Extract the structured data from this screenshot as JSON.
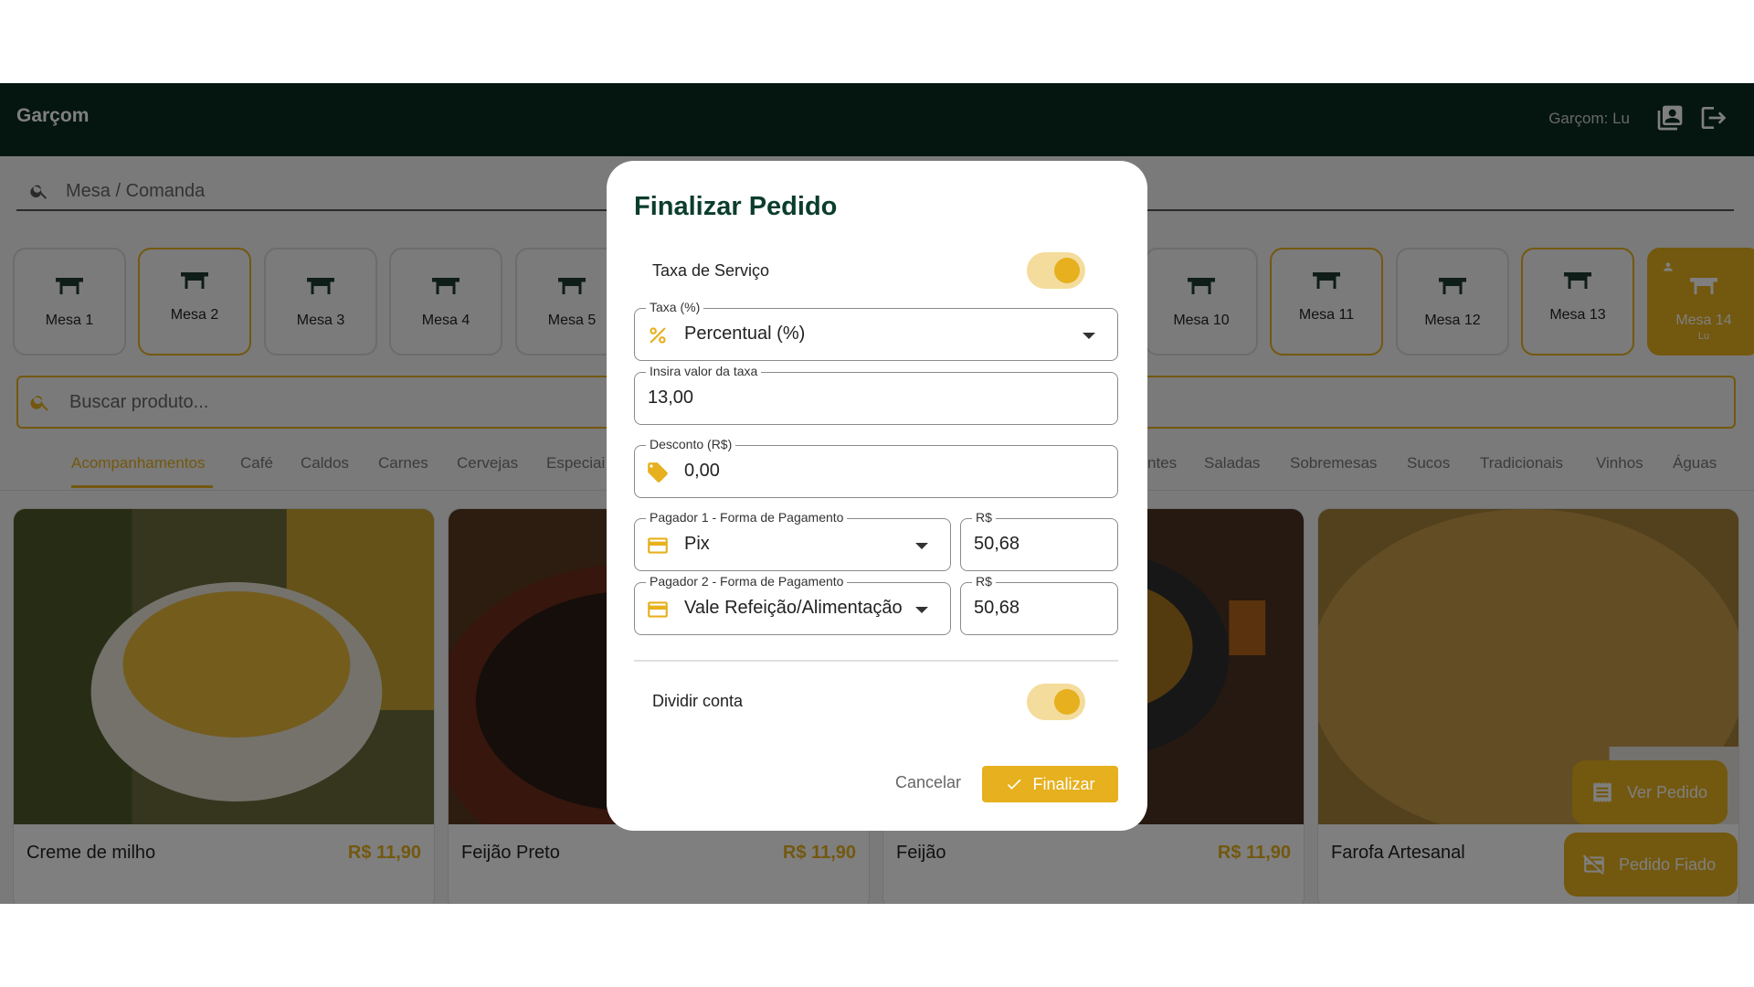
{
  "header": {
    "brand": "Garçom",
    "user_label": "Garçom: Lu",
    "icons": [
      "orders-icon",
      "logout-icon"
    ]
  },
  "mesa_search": {
    "placeholder": "Mesa / Comanda"
  },
  "mesas": [
    {
      "label": "Mesa 1",
      "state": "free"
    },
    {
      "label": "Mesa 2",
      "state": "busy"
    },
    {
      "label": "Mesa 3",
      "state": "free"
    },
    {
      "label": "Mesa 4",
      "state": "free"
    },
    {
      "label": "Mesa 5",
      "state": "free"
    },
    {
      "label": "Mesa 10",
      "state": "free"
    },
    {
      "label": "Mesa 11",
      "state": "busy"
    },
    {
      "label": "Mesa 12",
      "state": "free"
    },
    {
      "label": "Mesa 13",
      "state": "busy"
    },
    {
      "label": "Mesa 14",
      "state": "active",
      "sub": "Lu"
    }
  ],
  "product_search": {
    "placeholder": "Buscar produto..."
  },
  "tabs": [
    {
      "label": "Acompanhamentos",
      "active": true
    },
    {
      "label": "Café"
    },
    {
      "label": "Caldos"
    },
    {
      "label": "Carnes"
    },
    {
      "label": "Cervejas"
    },
    {
      "label": "Especiai"
    },
    {
      "label": "ntes"
    },
    {
      "label": "Saladas"
    },
    {
      "label": "Sobremesas"
    },
    {
      "label": "Sucos"
    },
    {
      "label": "Tradicionais"
    },
    {
      "label": "Vinhos"
    },
    {
      "label": "Águas"
    }
  ],
  "products": [
    {
      "name": "Creme de milho",
      "price": "R$ 11,90"
    },
    {
      "name": "Feijão Preto",
      "price": "R$ 11,90"
    },
    {
      "name": "Feijão",
      "price": "R$ 11,90"
    },
    {
      "name": "Farofa Artesanal",
      "price": ""
    }
  ],
  "fabs": {
    "ver_pedido": "Ver Pedido",
    "pedido_fiado": "Pedido Fiado"
  },
  "dialog": {
    "title": "Finalizar Pedido",
    "taxa_servico_label": "Taxa de Serviço",
    "taxa_servico_on": true,
    "taxa_tipo": {
      "label": "Taxa (%)",
      "value": "Percentual (%)"
    },
    "taxa_valor": {
      "label": "Insira valor da taxa",
      "value": "13,00"
    },
    "desconto": {
      "label": "Desconto (R$)",
      "value": "0,00"
    },
    "pagador1": {
      "label": "Pagador 1 - Forma de Pagamento",
      "value": "Pix",
      "amount_label": "R$",
      "amount": "50,68"
    },
    "pagador2": {
      "label": "Pagador 2 - Forma de Pagamento",
      "value": "Vale Refeição/Alimentação",
      "amount_label": "R$",
      "amount": "50,68"
    },
    "dividir_label": "Dividir conta",
    "dividir_on": true,
    "cancel_label": "Cancelar",
    "confirm_label": "Finalizar"
  },
  "colors": {
    "header": "#0b2a20",
    "accent": "#e6b01e",
    "title": "#0b3d2c"
  }
}
